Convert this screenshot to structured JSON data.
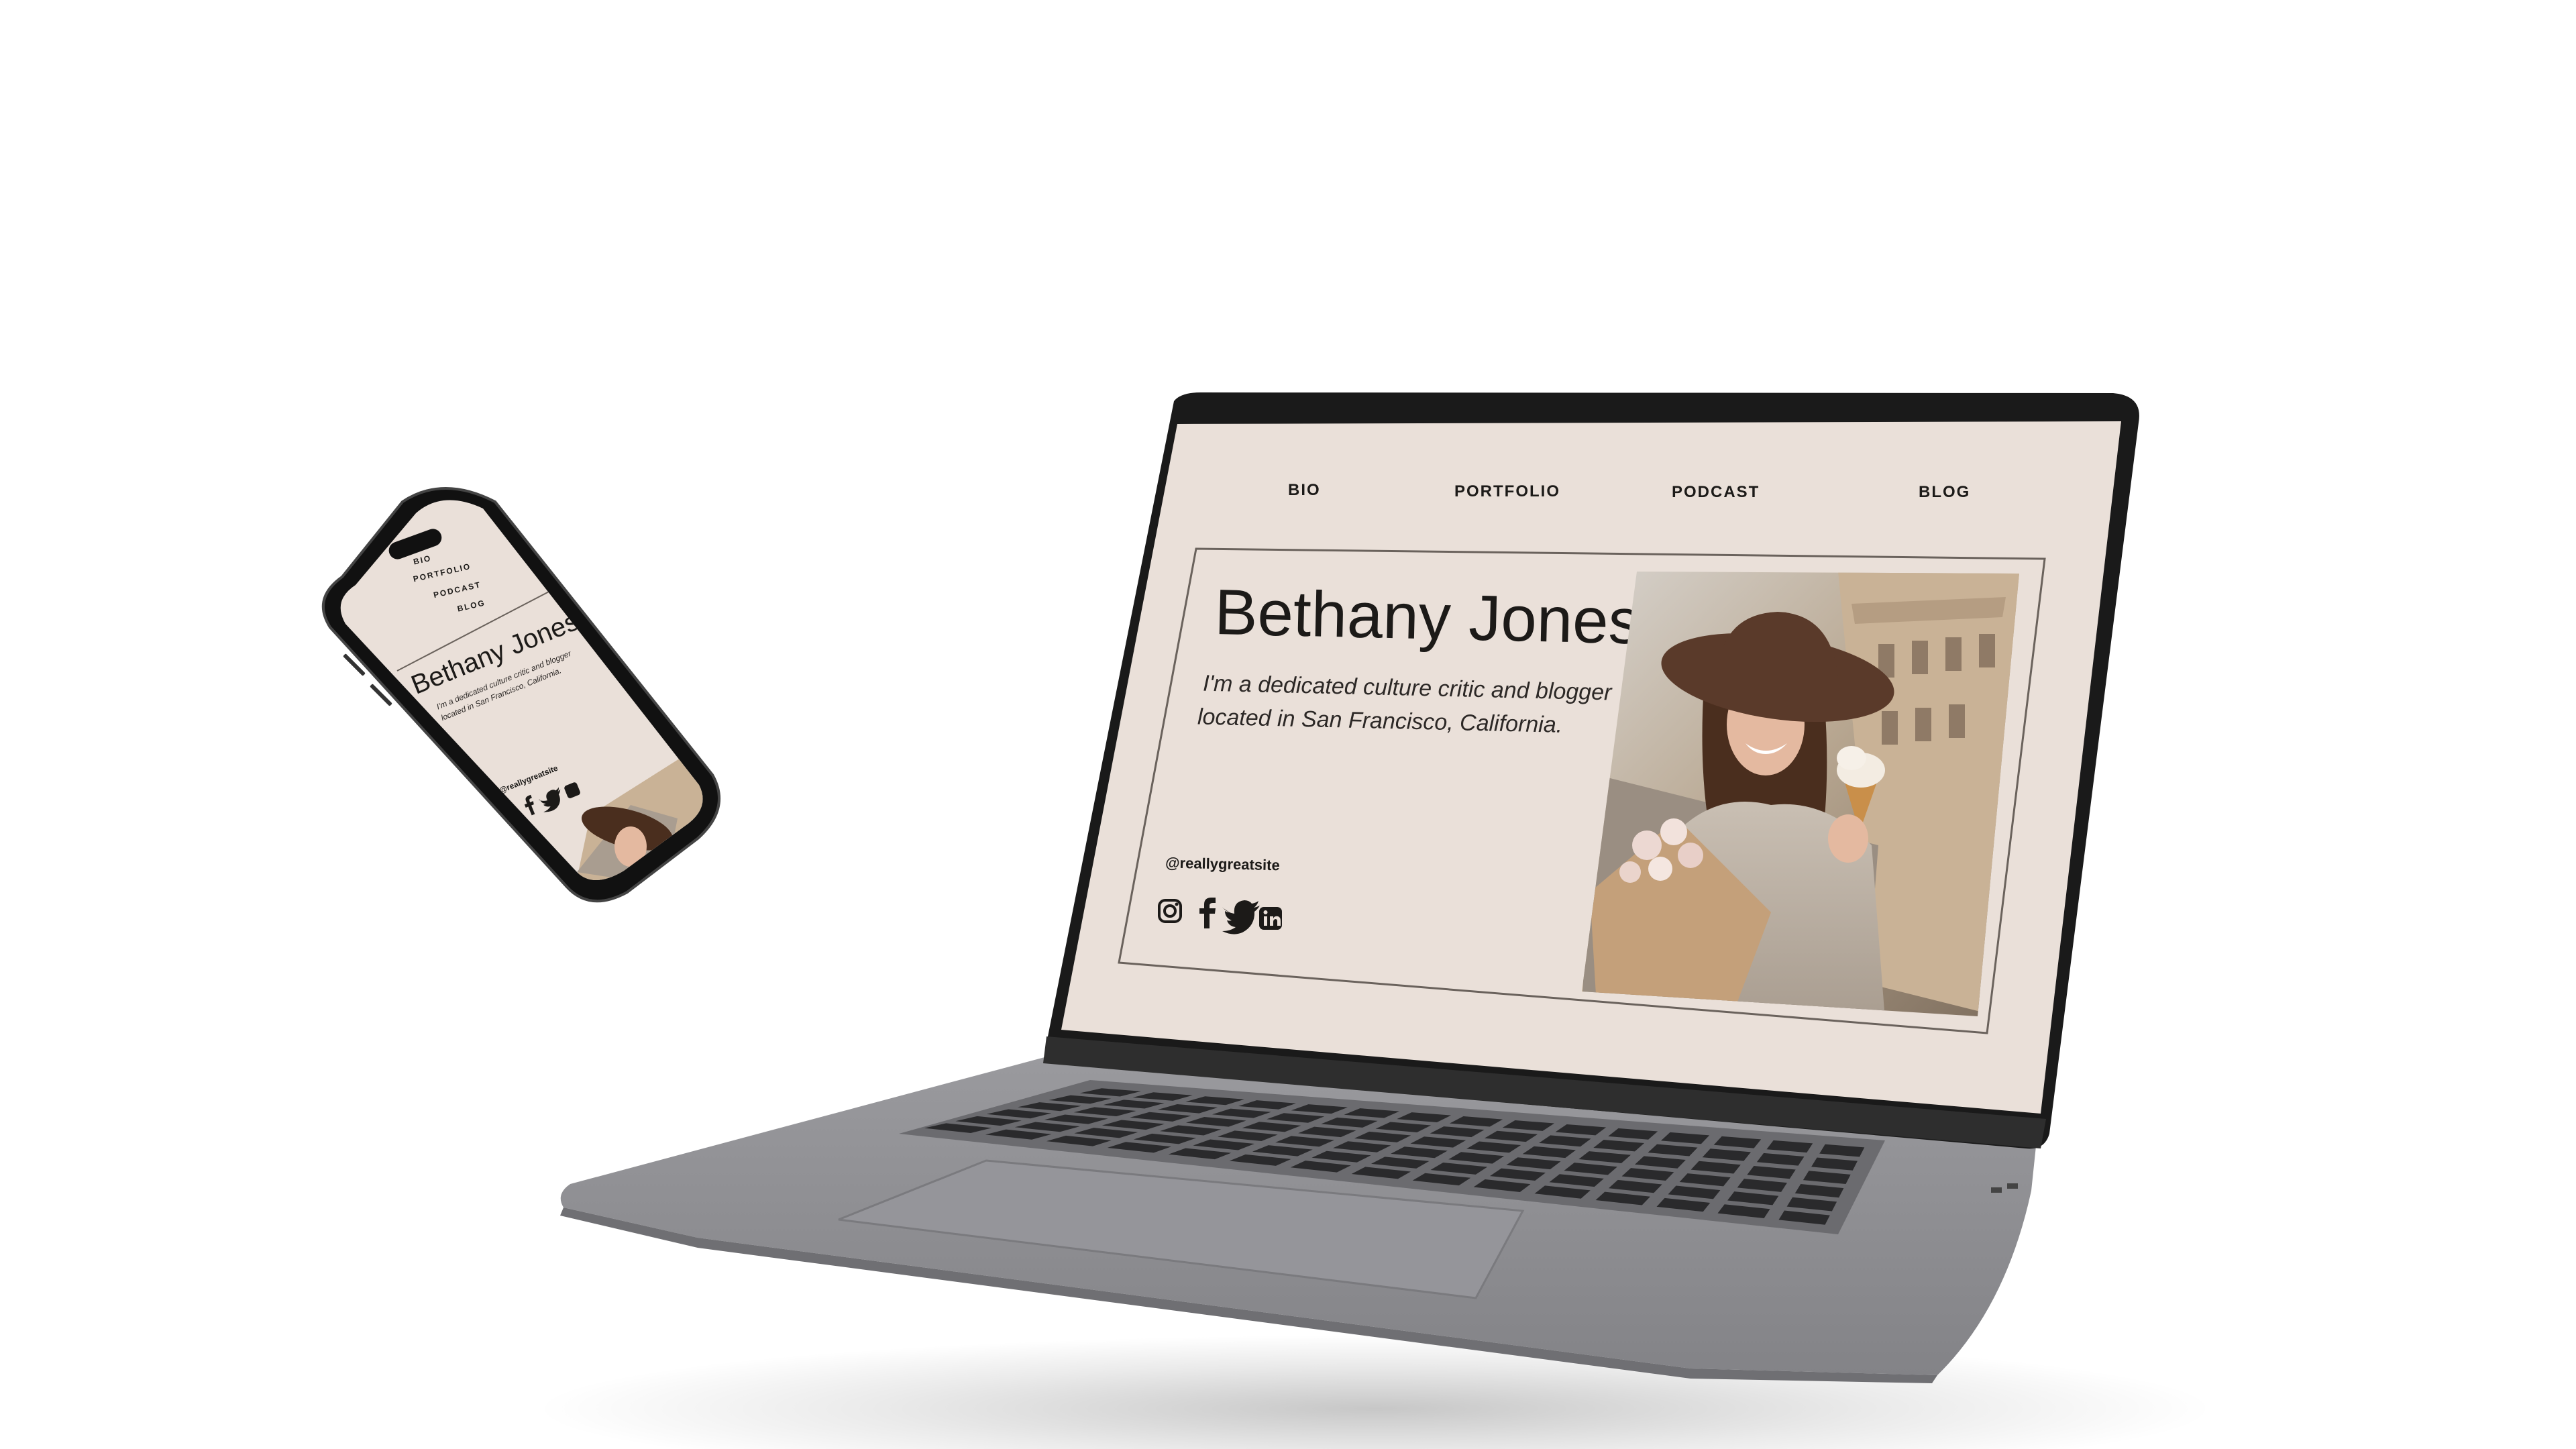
{
  "site": {
    "nav": [
      "BIO",
      "PORTFOLIO",
      "PODCAST",
      "BLOG"
    ],
    "name": "Bethany Jones",
    "tagline_line1": "I'm a dedicated culture critic and blogger",
    "tagline_line2": "located in San Francisco, California.",
    "handle": "@reallygreatsite",
    "socials": [
      "instagram-icon",
      "facebook-icon",
      "twitter-icon",
      "linkedin-icon"
    ]
  },
  "colors": {
    "page_bg": "#ffffff",
    "site_bg": "#eae0d9",
    "text": "#1c1a18",
    "laptop_body": "#8e8e92",
    "bezel": "#1a1a1a"
  }
}
